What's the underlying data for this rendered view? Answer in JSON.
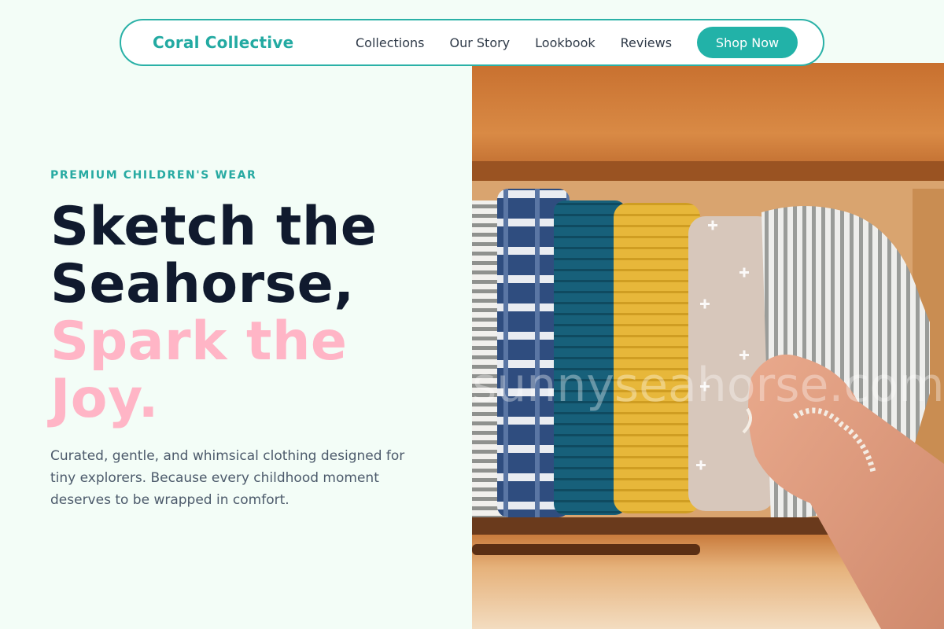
{
  "nav": {
    "brand": "Coral Collective",
    "links": [
      "Collections",
      "Our Story",
      "Lookbook",
      "Reviews"
    ],
    "cta": "Shop Now"
  },
  "hero": {
    "eyebrow": "PREMIUM CHILDREN'S WEAR",
    "headline_line1": "Sketch the",
    "headline_line2": "Seahorse,",
    "headline_line3": "Spark the",
    "headline_line4": "Joy.",
    "subcopy": "Curated, gentle, and whimsical clothing designed for tiny explorers. Because every childhood moment deserves to be wrapped in comfort."
  },
  "image": {
    "watermark": "sunnyseahorse.com"
  },
  "colors": {
    "accent": "#22b2a8",
    "headline": "#101a2e",
    "highlight": "#ffb5c6",
    "background": "#f3fdf7"
  }
}
